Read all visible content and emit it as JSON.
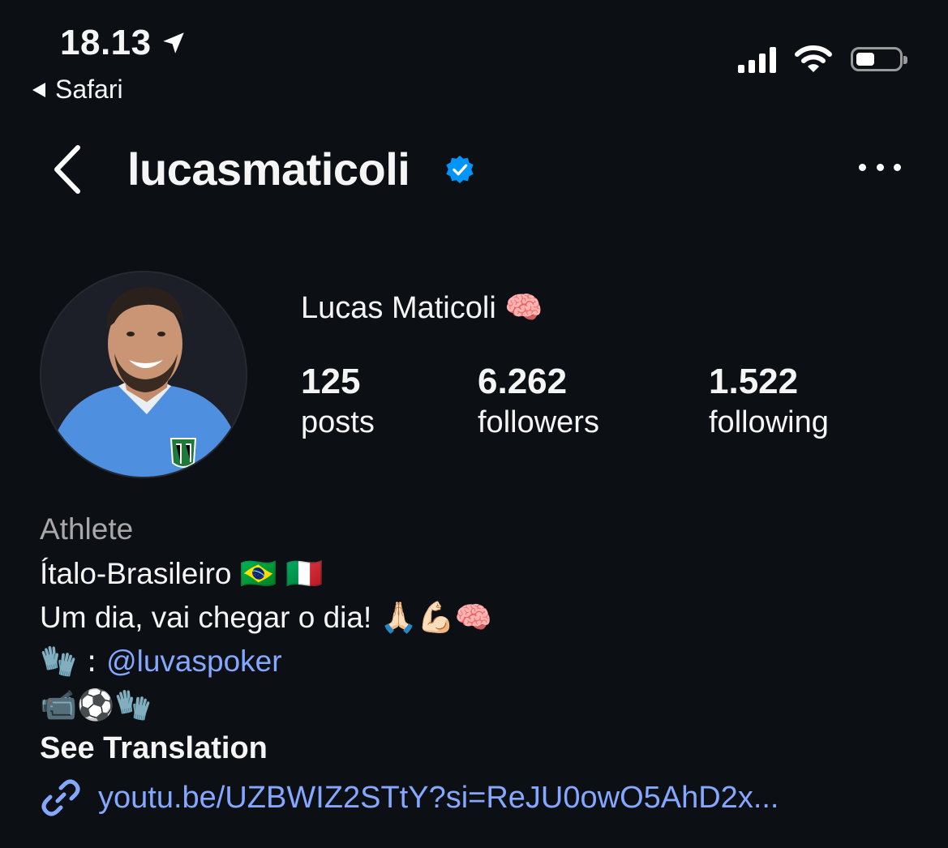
{
  "status_bar": {
    "time": "18.13",
    "back_app": "Safari"
  },
  "header": {
    "username": "lucasmaticoli"
  },
  "profile": {
    "full_name": "Lucas Maticoli 🧠",
    "stats": {
      "posts_count": "125",
      "posts_label": "posts",
      "followers_count": "6.262",
      "followers_label": "followers",
      "following_count": "1.522",
      "following_label": "following"
    },
    "category": "Athlete",
    "bio": {
      "line1": "Ítalo-Brasileiro 🇧🇷 🇮🇹",
      "line2": "Um dia, vai chegar o dia! 🙏🏻💪🏻🧠",
      "line3_prefix": "🧤 : ",
      "line3_mention": "@luvaspoker",
      "line4": "📹⚽🧤"
    },
    "see_translation": "See Translation",
    "link": "youtu.be/UZBWIZ2STtY?si=ReJU0owO5AhD2x..."
  },
  "colors": {
    "background": "#0c1014",
    "link": "#85a7ff",
    "verified": "#0095f6"
  }
}
